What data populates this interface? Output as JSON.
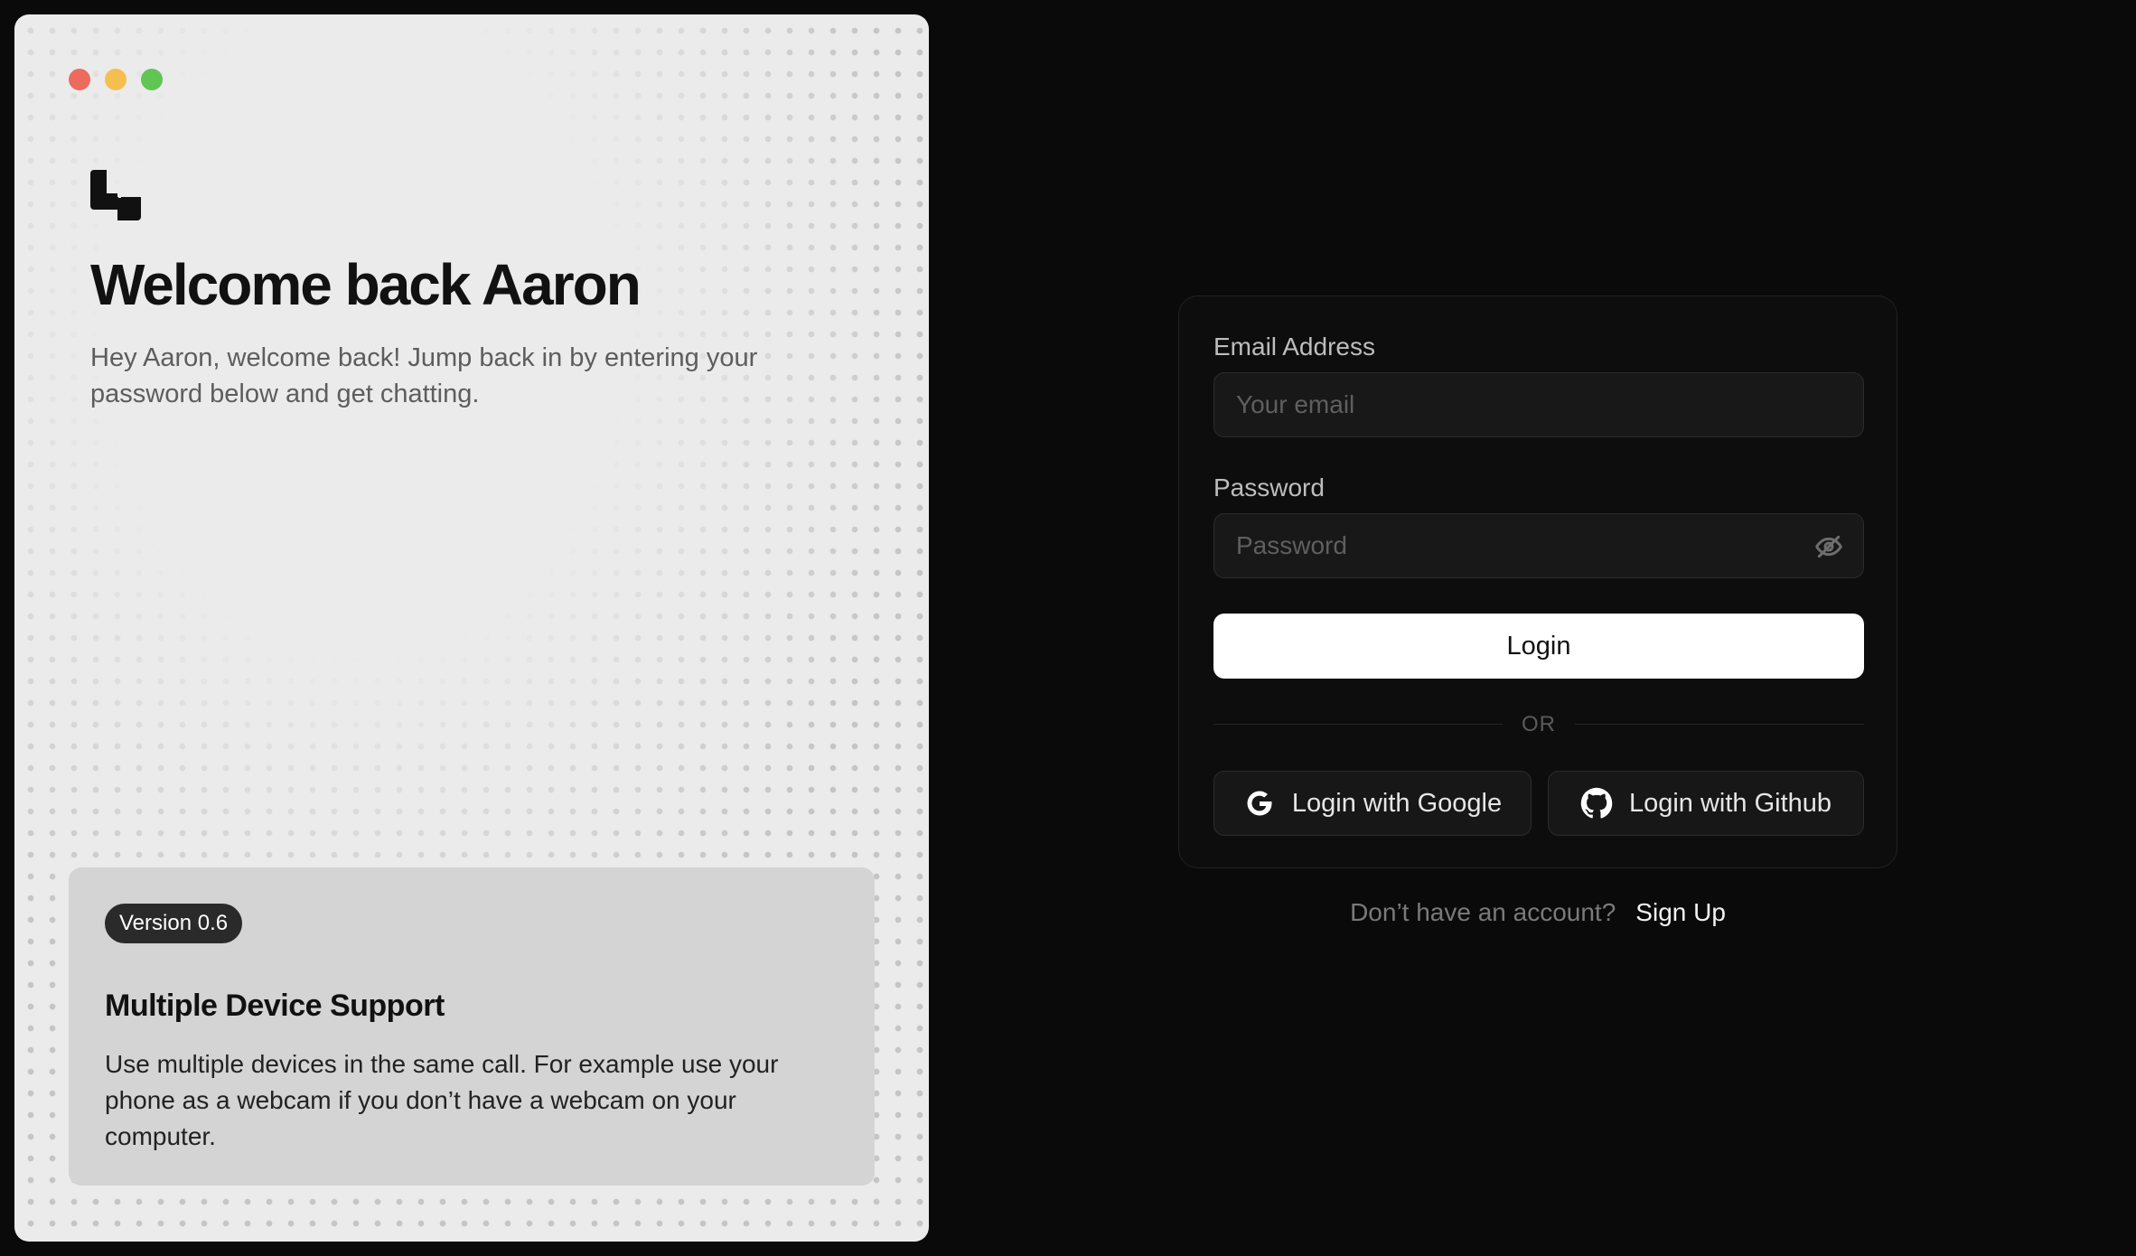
{
  "brand": {
    "logo_icon": "app-logo-icon"
  },
  "window_controls": [
    "close",
    "minimize",
    "maximize"
  ],
  "welcome": {
    "title": "Welcome back Aaron",
    "subtitle": "Hey Aaron, welcome back! Jump back in by entering your password below and get chatting."
  },
  "feature": {
    "badge": "Version 0.6",
    "title": "Multiple Device Support",
    "description": "Use multiple devices in the same call. For example use your phone as a webcam if you don’t have a webcam on your computer."
  },
  "login_form": {
    "email_label": "Email Address",
    "email_placeholder": "Your email",
    "email_value": "",
    "password_label": "Password",
    "password_placeholder": "Password",
    "password_value": "",
    "password_toggle_icon": "eye-off-icon",
    "login_button": "Login",
    "divider": "OR",
    "google_button": "Login with Google",
    "google_icon": "google-icon",
    "github_button": "Login with Github",
    "github_icon": "github-icon"
  },
  "signup": {
    "prompt": "Don’t have an account?",
    "link": "Sign Up"
  },
  "colors": {
    "background": "#0a0a0a",
    "left_panel": "#ebebeb",
    "card": "#d4d4d4",
    "primary_button": "#ffffff",
    "traffic_red": "#ec6a5e",
    "traffic_yellow": "#f4bf4f",
    "traffic_green": "#61c554"
  }
}
